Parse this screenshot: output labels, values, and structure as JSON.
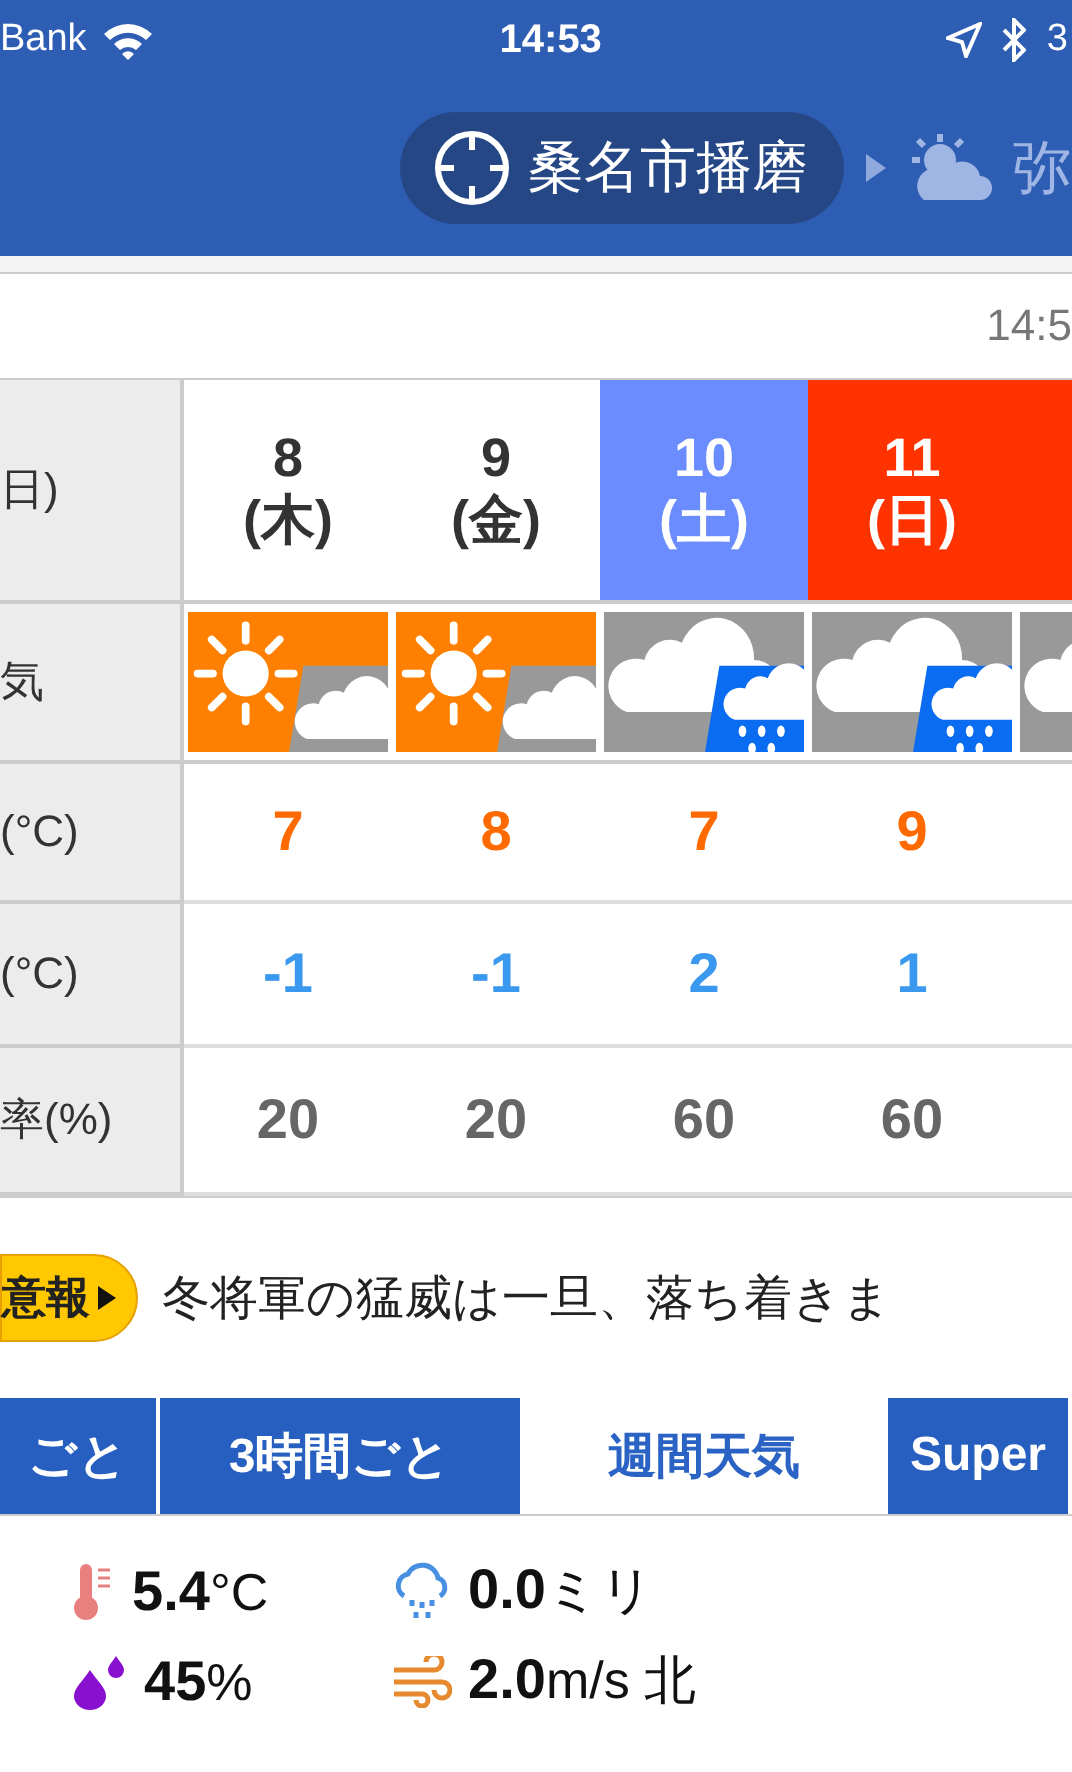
{
  "status_bar": {
    "carrier": "Bank",
    "time": "14:53",
    "battery": "3"
  },
  "header": {
    "location": "桑名市播磨",
    "next_location": "弥"
  },
  "updated": "14:5",
  "table": {
    "row_labels": [
      "日)",
      "気",
      "(°C)",
      "(°C)",
      "率(%)"
    ],
    "days": [
      {
        "date": "8",
        "weekday": "(木)",
        "kind": "weekday",
        "weather": [
          {
            "kind": "sunny"
          },
          {
            "kind": "cloudy"
          }
        ],
        "high": "7",
        "low": "-1",
        "pop": "20"
      },
      {
        "date": "9",
        "weekday": "(金)",
        "kind": "weekday",
        "weather": [
          {
            "kind": "sunny"
          },
          {
            "kind": "cloudy"
          }
        ],
        "high": "8",
        "low": "-1",
        "pop": "20"
      },
      {
        "date": "10",
        "weekday": "(土)",
        "kind": "saturday",
        "weather": [
          {
            "kind": "cloudy"
          },
          {
            "kind": "rain"
          }
        ],
        "high": "7",
        "low": "2",
        "pop": "60"
      },
      {
        "date": "11",
        "weekday": "(日)",
        "kind": "sunday",
        "weather": [
          {
            "kind": "cloudy"
          },
          {
            "kind": "rain"
          }
        ],
        "high": "9",
        "low": "1",
        "pop": "60"
      },
      {
        "kind": "holiday",
        "weather": [
          {
            "kind": "cloudy"
          }
        ]
      }
    ]
  },
  "notice": {
    "badge": "意報",
    "text": "冬将軍の猛威は一旦、落ち着きま"
  },
  "tabs": [
    {
      "label": "ごと",
      "selected": false
    },
    {
      "label": "3時間ごと",
      "selected": false
    },
    {
      "label": "週間天気",
      "selected": true
    },
    {
      "label": "Super",
      "selected": false
    }
  ],
  "stats": [
    {
      "kind": "temperature",
      "value": "5.4",
      "unit": "°C"
    },
    {
      "kind": "precipitation",
      "value": "0.0",
      "unit": "ミリ"
    },
    {
      "kind": "humidity",
      "value": "45",
      "unit": "%"
    },
    {
      "kind": "wind",
      "value": "2.0",
      "unit": "m/s 北"
    }
  ]
}
